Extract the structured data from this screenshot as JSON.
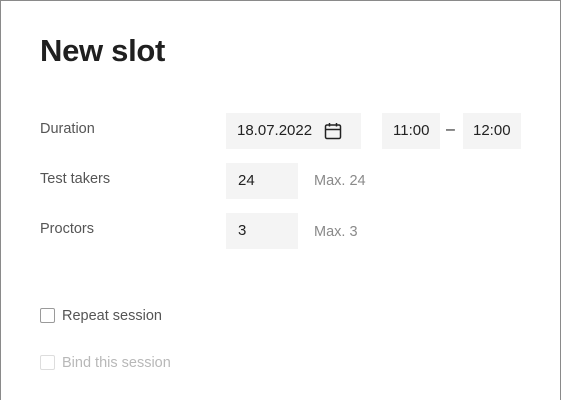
{
  "dialog": {
    "title": "New slot"
  },
  "duration": {
    "label": "Duration",
    "date": "18.07.2022",
    "date_icon": "calendar-icon",
    "time_start": "11:00",
    "separator": "–",
    "time_end": "12:00"
  },
  "test_takers": {
    "label": "Test takers",
    "value": "24",
    "max_text": "Max. 24"
  },
  "proctors": {
    "label": "Proctors",
    "value": "3",
    "max_text": "Max. 3"
  },
  "options": {
    "repeat_session": {
      "label": "Repeat session",
      "checked": false,
      "enabled": true
    },
    "bind_session": {
      "label": "Bind this session",
      "checked": false,
      "enabled": false
    }
  }
}
